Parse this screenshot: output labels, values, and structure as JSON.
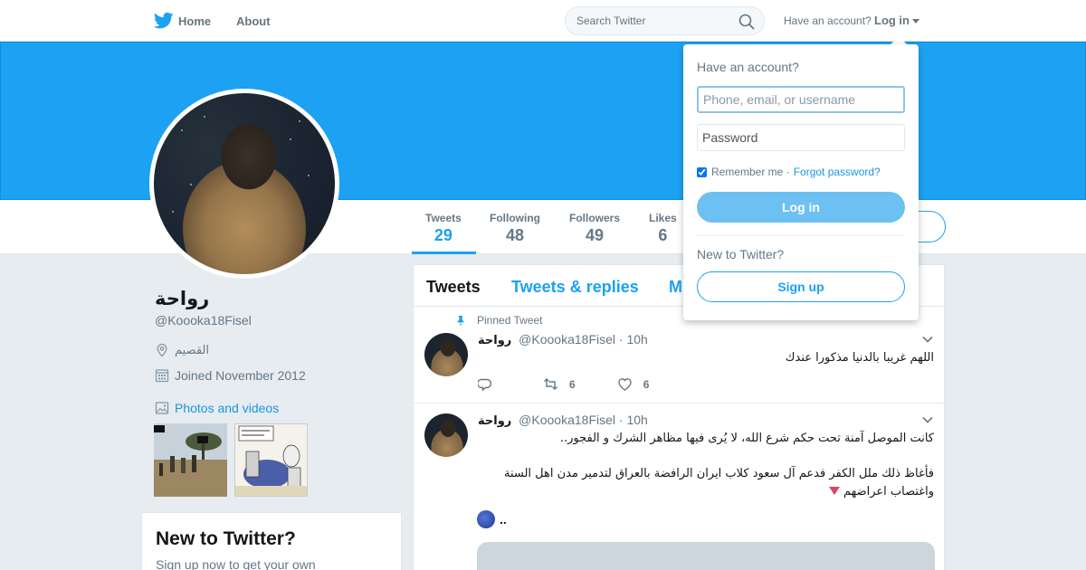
{
  "nav": {
    "home": "Home",
    "about": "About",
    "search_placeholder": "Search Twitter",
    "have_account": "Have an account?",
    "login": "Log in"
  },
  "stats": [
    {
      "label": "Tweets",
      "value": "29"
    },
    {
      "label": "Following",
      "value": "48"
    },
    {
      "label": "Followers",
      "value": "49"
    },
    {
      "label": "Likes",
      "value": "6"
    }
  ],
  "profile": {
    "name": "رواحة",
    "handle": "@Koooka18Fisel",
    "location": "القصيم",
    "joined": "Joined November 2012",
    "photos_link": "Photos and videos"
  },
  "new_card": {
    "title": "New to Twitter?",
    "subtitle": "Sign up now to get your own"
  },
  "timeline": {
    "tabs": [
      "Tweets",
      "Tweets & replies",
      "M"
    ],
    "tweets": [
      {
        "pinned_label": "Pinned Tweet",
        "name": "رواحة",
        "handle": "@Koooka18Fisel",
        "time": "· 10h",
        "text": "اللهم غريبا بالدنيا مذكورا عندك",
        "retweets": "6",
        "likes": "6"
      },
      {
        "name": "رواحة",
        "handle": "@Koooka18Fisel",
        "time": "· 10h",
        "text_line1": "كانت الموصل آمنة تحت حكم شرع الله، لا يُرى فيها مظاهر الشرك و الفجور..",
        "text_line2": "فأغاظ ذلك ملل الكفر فدعم آل سعود كلاب ايران الرافضة بالعراق لتدمير مدن اهل السنة واغتصاب اعراضهم",
        "emoji_text": ".."
      }
    ]
  },
  "login_dropdown": {
    "title": "Have an account?",
    "username_placeholder": "Phone, email, or username",
    "password_placeholder": "Password",
    "remember": "Remember me ·",
    "forgot": "Forgot password?",
    "login_button": "Log in",
    "new_to_twitter": "New to Twitter?",
    "signup_button": "Sign up"
  },
  "colors": {
    "brand": "#1da1f2",
    "banner": "#1da1f2",
    "login_button": "#6cc1f2"
  },
  "icons": [
    "twitter-bird-icon",
    "search-icon",
    "location-icon",
    "calendar-icon",
    "photo-icon",
    "pin-icon",
    "reply-icon",
    "retweet-icon",
    "like-icon",
    "chevron-down-icon"
  ]
}
